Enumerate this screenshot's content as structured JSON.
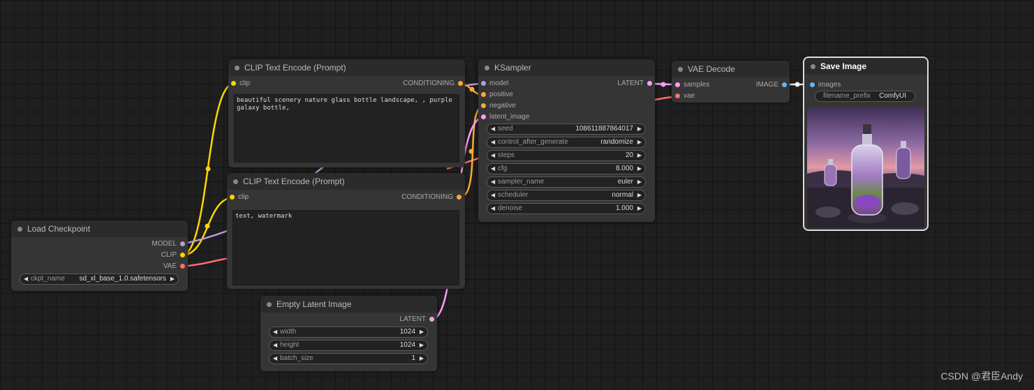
{
  "colors": {
    "clip": "#ffd500",
    "conditioning": "#ffa931",
    "model": "#b39ddb",
    "latent": "#ff9cf9",
    "vae": "#ff6e6e",
    "image": "#64b5f6"
  },
  "nodes": {
    "clip_pos": {
      "title": "CLIP Text Encode (Prompt)",
      "input": "clip",
      "output": "CONDITIONING",
      "text": "beautiful scenery nature glass bottle landscape, , purple galaxy bottle,"
    },
    "clip_neg": {
      "title": "CLIP Text Encode (Prompt)",
      "input": "clip",
      "output": "CONDITIONING",
      "text": "text, watermark"
    },
    "checkpoint": {
      "title": "Load Checkpoint",
      "outputs": [
        "MODEL",
        "CLIP",
        "VAE"
      ],
      "ckpt_label": "ckpt_name",
      "ckpt_value": "sd_xl_base_1.0.safetensors"
    },
    "latent": {
      "title": "Empty Latent Image",
      "output": "LATENT",
      "widgets": [
        {
          "label": "width",
          "value": "1024"
        },
        {
          "label": "height",
          "value": "1024"
        },
        {
          "label": "batch_size",
          "value": "1"
        }
      ]
    },
    "ksampler": {
      "title": "KSampler",
      "inputs": [
        "model",
        "positive",
        "negative",
        "latent_image"
      ],
      "output": "LATENT",
      "widgets": [
        {
          "label": "seed",
          "value": "108611887864017"
        },
        {
          "label": "control_after_generate",
          "value": "randomize"
        },
        {
          "label": "steps",
          "value": "20"
        },
        {
          "label": "cfg",
          "value": "8.000"
        },
        {
          "label": "sampler_name",
          "value": "euler"
        },
        {
          "label": "scheduler",
          "value": "normal"
        },
        {
          "label": "denoise",
          "value": "1.000"
        }
      ]
    },
    "vae_decode": {
      "title": "VAE Decode",
      "inputs": [
        "samples",
        "vae"
      ],
      "output": "IMAGE"
    },
    "save_image": {
      "title": "Save Image",
      "input": "images",
      "prefix_label": "filename_prefix",
      "prefix_value": "ComfyUI"
    }
  },
  "watermark": "CSDN @君臣Andy"
}
